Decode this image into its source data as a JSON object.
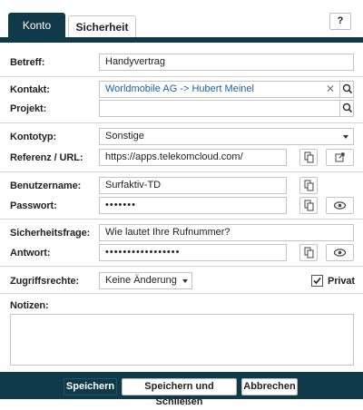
{
  "tabs": {
    "account": "Konto",
    "security": "Sicherheit",
    "help": "?"
  },
  "form": {
    "subject": {
      "label": "Betreff:",
      "value": "Handyvertrag"
    },
    "contact": {
      "label": "Kontakt:",
      "value": "Worldmobile AG -> Hubert Meinel"
    },
    "project": {
      "label": "Projekt:",
      "value": ""
    },
    "account_type": {
      "label": "Kontotyp:",
      "value": "Sonstige"
    },
    "reference": {
      "label": "Referenz / URL:",
      "value": "https://apps.telekomcloud.com/"
    },
    "username": {
      "label": "Benutzername:",
      "value": "Surfaktiv-TD"
    },
    "password": {
      "label": "Passwort:",
      "value": "•••••••"
    },
    "security_question": {
      "label": "Sicherheitsfrage:",
      "value": "Wie lautet Ihre Rufnummer?"
    },
    "answer": {
      "label": "Antwort:",
      "value": "•••••••••••••••••"
    },
    "access_rights": {
      "label": "Zugriffsrechte:",
      "value": "Keine Änderung"
    },
    "private": {
      "label": "Privat",
      "checked": true
    },
    "notes": {
      "label": "Notizen:",
      "value": ""
    }
  },
  "footer": {
    "save": "Speichern",
    "save_close": "Speichern und Schließen",
    "cancel": "Abbrechen"
  },
  "colors": {
    "accent": "#103a4a",
    "link": "#1e5fa6"
  },
  "icons": {
    "copy": "copy-icon",
    "open_link": "external-link-icon",
    "show_password": "eye-icon",
    "search": "search-icon",
    "clear": "clear-icon",
    "dropdown": "chevron-down-icon",
    "checkbox": "checkmark-icon"
  }
}
